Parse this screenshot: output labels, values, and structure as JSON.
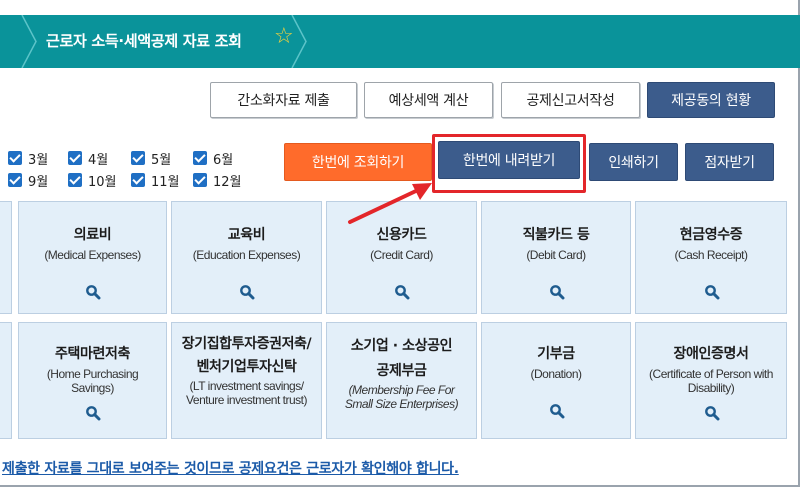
{
  "header": {
    "title": "근로자 소득·세액공제 자료 조회",
    "star_icon": "star-outline-icon"
  },
  "top_buttons": {
    "simplified_submit": "간소화자료 제출",
    "tax_estimate": "예상세액 계산",
    "deduction_form": "공제신고서작성",
    "provided_status": "제공동의 현황"
  },
  "months": [
    "3월",
    "4월",
    "5월",
    "6월",
    "9월",
    "10월",
    "11월",
    "12월"
  ],
  "action_buttons": {
    "bulk_view": "한번에 조회하기",
    "bulk_download": "한번에 내려받기",
    "print": "인쇄하기",
    "braille": "점자받기"
  },
  "cards_row1": [
    {
      "title": "의료비",
      "sub": "(Medical Expenses)"
    },
    {
      "title": "교육비",
      "sub": "(Education Expenses)"
    },
    {
      "title": "신용카드",
      "sub": "(Credit Card)"
    },
    {
      "title": "직불카드 등",
      "sub": "(Debit Card)"
    },
    {
      "title": "현금영수증",
      "sub": "(Cash Receipt)"
    }
  ],
  "cards_row2": [
    {
      "title": "주택마련저축",
      "sub1": "(Home Purchasing",
      "sub2": "Savings)"
    },
    {
      "title1": "장기집합투자증권저축/",
      "title2": "벤처기업투자신탁",
      "sub1": "(LT investment savings/",
      "sub2": "Venture investment trust)"
    },
    {
      "title1": "소기업 · 소상공인",
      "title2": "공제부금",
      "sub1": "(Membership Fee For",
      "sub2": "Small Size Enterprises)"
    },
    {
      "title": "기부금",
      "sub": "(Donation)"
    },
    {
      "title": "장애인증명서",
      "sub1": "(Certificate of Person with",
      "sub2": "Disability)"
    }
  ],
  "bottom_note": "제출한 자료를 그대로 보여주는 것이므로 공제요건은 근로자가 확인해야 합니다.",
  "colors": {
    "header": "#0a939a",
    "navy_button": "#3c5c8c",
    "orange_button": "#ff6b2b",
    "highlight": "#e3262a",
    "card_bg": "#e3eff9",
    "link": "#1b5aa8"
  }
}
